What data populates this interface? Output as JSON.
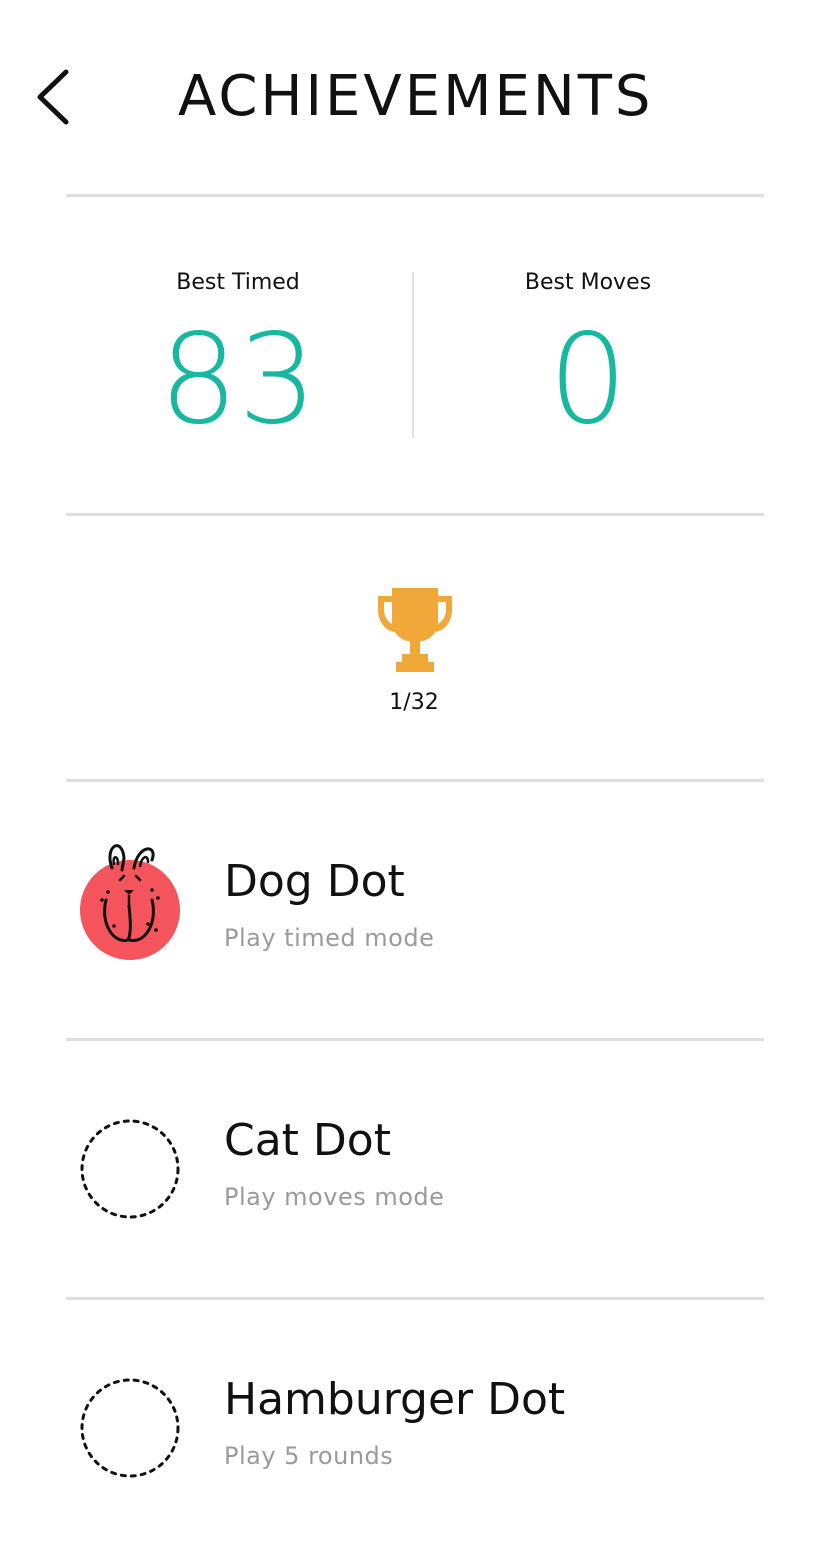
{
  "header": {
    "title": "ACHIEVEMENTS",
    "back_icon": "chevron-left-icon"
  },
  "stats": {
    "best_timed": {
      "label": "Best Timed",
      "value": "83"
    },
    "best_moves": {
      "label": "Best Moves",
      "value": "0"
    }
  },
  "trophy": {
    "icon": "trophy-icon",
    "progress": "1/32",
    "unlocked": 1,
    "total": 32
  },
  "achievements": [
    {
      "name": "Dog Dot",
      "description": "Play timed mode",
      "unlocked": true,
      "icon": "dog-dot-icon"
    },
    {
      "name": "Cat Dot",
      "description": "Play moves mode",
      "unlocked": false,
      "icon": "locked-dot-icon"
    },
    {
      "name": "Hamburger Dot",
      "description": "Play 5 rounds",
      "unlocked": false,
      "icon": "locked-dot-icon"
    }
  ],
  "colors": {
    "accent_teal": "#18b8a0",
    "trophy_gold": "#f0a838",
    "dog_red": "#f4545c",
    "divider": "#dedede",
    "muted_text": "#9a9a9a"
  }
}
